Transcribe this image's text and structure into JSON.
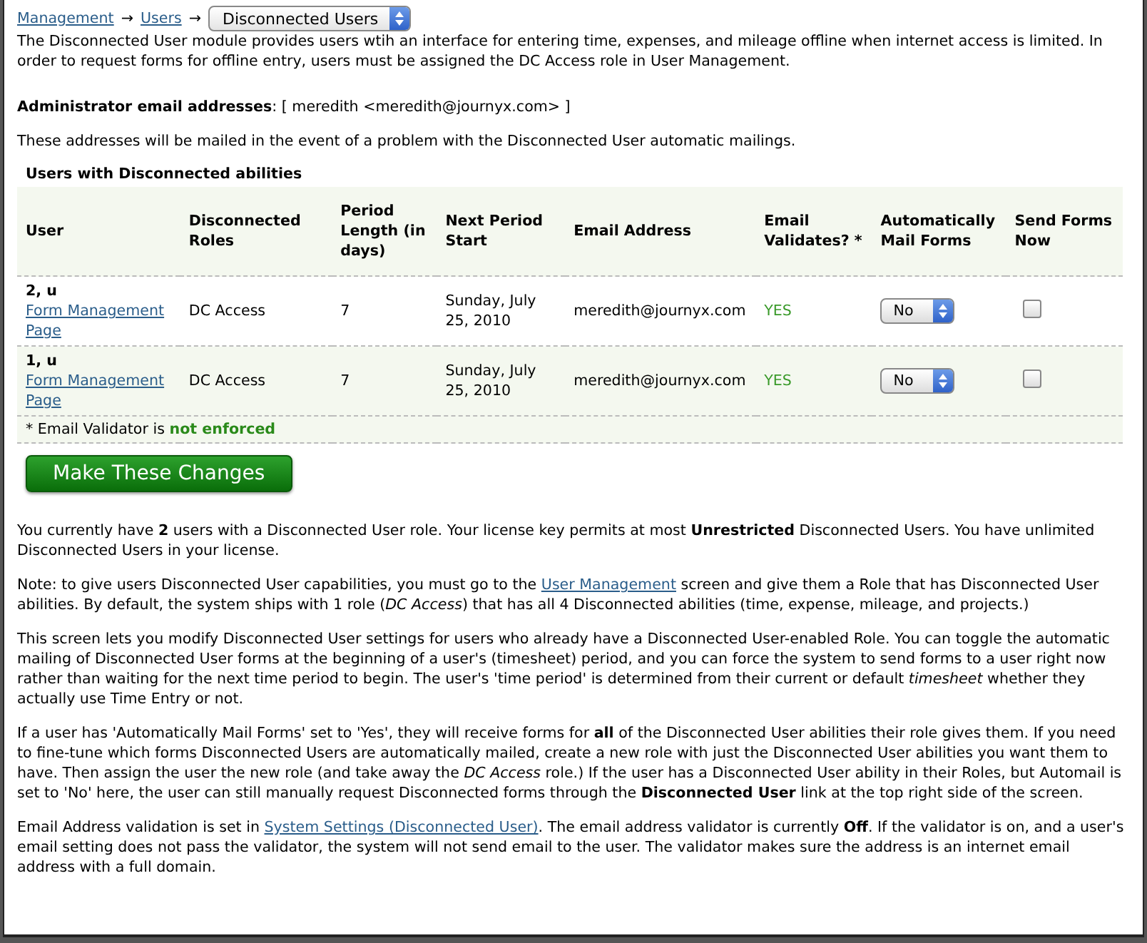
{
  "breadcrumb": {
    "links": [
      "Management",
      "Users"
    ],
    "separator": "→",
    "select": "Disconnected Users"
  },
  "intro": "The Disconnected User module provides users wtih an interface for entering time, expenses, and mileage offline when internet access is limited. In order to request forms for offline entry, users must be assigned the DC Access role in User Management.",
  "admin": {
    "label": "Administrator email addresses",
    "value": ": [ meredith <meredith@journyx.com> ]"
  },
  "admin_note": "These addresses will be mailed in the event of a problem with the Disconnected User automatic mailings.",
  "table": {
    "title": "Users with Disconnected abilities",
    "columns": [
      "User",
      "Disconnected Roles",
      "Period Length (in days)",
      "Next Period Start",
      "Email Address",
      "Email Validates? *",
      "Automatically Mail Forms",
      "Send Forms Now"
    ],
    "rows": [
      {
        "user": "2, u",
        "link": "Form Management Page",
        "roles": "DC Access",
        "period": "7",
        "next_start": "Sunday, July 25, 2010",
        "email": "meredith@journyx.com",
        "validates": "YES",
        "auto_mail": "No",
        "send_now": false
      },
      {
        "user": "1, u",
        "link": "Form Management Page",
        "roles": "DC Access",
        "period": "7",
        "next_start": "Sunday, July 25, 2010",
        "email": "meredith@journyx.com",
        "validates": "YES",
        "auto_mail": "No",
        "send_now": false
      }
    ],
    "footnote": "* Email Validator is **not enforced**"
  },
  "submit": "Make These Changes",
  "paragraphs": [
    [
      {
        "kind": "text",
        "text": "You currently have **2** users with a Disconnected User role. Your license key permits at most **Unrestricted** Disconnected Users. You have unlimited Disconnected Users in your license."
      }
    ],
    [
      {
        "kind": "text",
        "text": "Note: to give users Disconnected User capabilities, you must go to the "
      },
      {
        "kind": "link",
        "text": "User Management"
      },
      {
        "kind": "text",
        "text": " screen and give them a Role that has Disconnected User abilities. By default, the system ships with 1 role (*DC Access*) that has all 4 Disconnected abilities (time, expense, mileage, and projects.)"
      }
    ],
    [
      {
        "kind": "text",
        "text": "This screen lets you modify Disconnected User settings for users who already have a Disconnected User-enabled Role. You can toggle the automatic mailing of Disconnected User forms at the beginning of a user's (timesheet) period, and you can force the system to send forms to a user right now rather than waiting for the next time period to begin. The user's 'time period' is determined from their current or default *timesheet* whether they actually use Time Entry or not."
      }
    ],
    [
      {
        "kind": "text",
        "text": "If a user has 'Automatically Mail Forms' set to 'Yes', they will receive forms for **all** of the Disconnected User abilities their role gives them. If you need to fine-tune which forms Disconnected Users are automatically mailed, create a new role with just the Disconnected User abilities you want them to have. Then assign the user the new role (and take away the *DC Access* role.) If the user has a Disconnected User ability in their Roles, but Automail is set to 'No' here, the user can still manually request Disconnected forms through the **Disconnected User** link at the top right side of the screen."
      }
    ],
    [
      {
        "kind": "text",
        "text": "Email Address validation is set in "
      },
      {
        "kind": "link",
        "text": "System Settings (Disconnected User)"
      },
      {
        "kind": "text",
        "text": ". The email address validator is currently **Off**. If the validator is on, and a user's email setting does not pass the validator, the system will not send email to the user. The validator makes sure the address is an internet email address with a full domain."
      }
    ]
  ]
}
